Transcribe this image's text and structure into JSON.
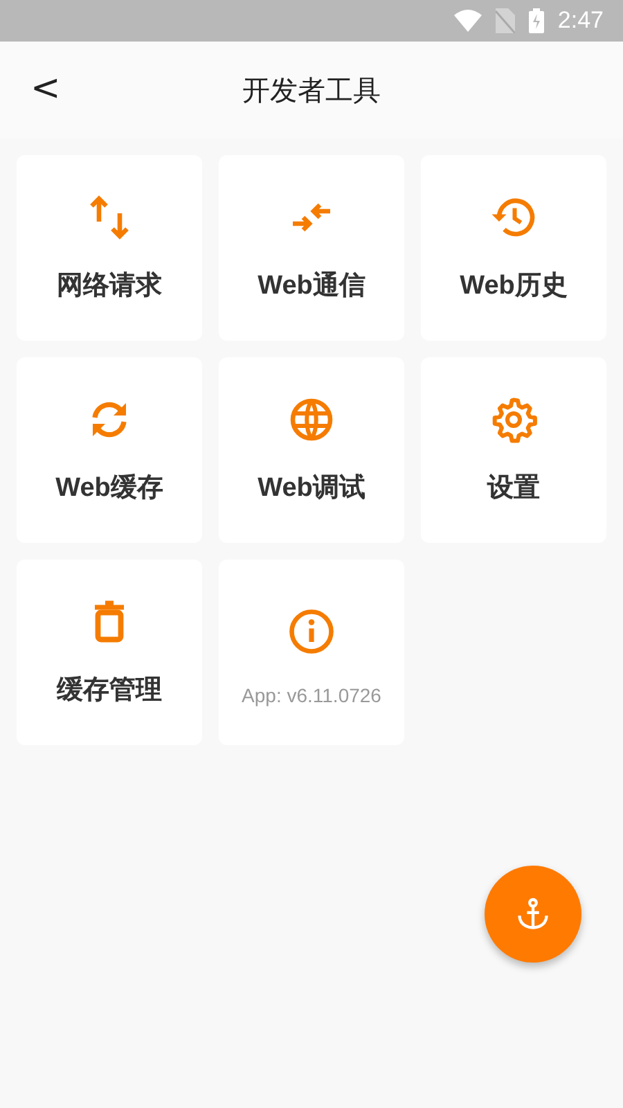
{
  "status_bar": {
    "time": "2:47"
  },
  "header": {
    "back": "<",
    "title": "开发者工具"
  },
  "tiles": [
    {
      "kind": "tool",
      "label": "网络请求"
    },
    {
      "kind": "tool",
      "label": "Web通信"
    },
    {
      "kind": "tool",
      "label": "Web历史"
    },
    {
      "kind": "tool",
      "label": "Web缓存"
    },
    {
      "kind": "tool",
      "label": "Web调试"
    },
    {
      "kind": "tool",
      "label": "设置"
    },
    {
      "kind": "tool",
      "label": "缓存管理"
    },
    {
      "kind": "about",
      "label": "App: v6.11.0726"
    }
  ]
}
